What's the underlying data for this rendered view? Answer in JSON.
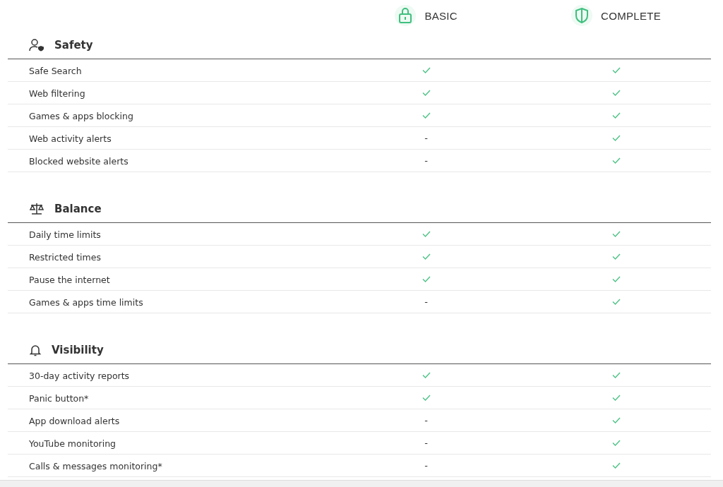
{
  "plans": [
    {
      "name": "BASIC",
      "kind": "lock"
    },
    {
      "name": "COMPLETE",
      "kind": "shield"
    }
  ],
  "sections": [
    {
      "title": "Safety",
      "kind": "person-shield",
      "rows": [
        {
          "feature": "Safe Search",
          "cells": [
            {
              "kind": "check"
            },
            {
              "kind": "check"
            }
          ]
        },
        {
          "feature": "Web filtering",
          "cells": [
            {
              "kind": "check"
            },
            {
              "kind": "check"
            }
          ]
        },
        {
          "feature": "Games & apps blocking",
          "cells": [
            {
              "kind": "check"
            },
            {
              "kind": "check"
            }
          ]
        },
        {
          "feature": "Web activity alerts",
          "cells": [
            {
              "kind": "text",
              "text": "-"
            },
            {
              "kind": "check"
            }
          ]
        },
        {
          "feature": "Blocked website alerts",
          "cells": [
            {
              "kind": "text",
              "text": "-"
            },
            {
              "kind": "check"
            }
          ]
        }
      ]
    },
    {
      "title": "Balance",
      "kind": "scale",
      "rows": [
        {
          "feature": "Daily time limits",
          "cells": [
            {
              "kind": "check"
            },
            {
              "kind": "check"
            }
          ]
        },
        {
          "feature": "Restricted times",
          "cells": [
            {
              "kind": "check"
            },
            {
              "kind": "check"
            }
          ]
        },
        {
          "feature": "Pause the internet",
          "cells": [
            {
              "kind": "check"
            },
            {
              "kind": "check"
            }
          ]
        },
        {
          "feature": "Games & apps time limits",
          "cells": [
            {
              "kind": "text",
              "text": "-"
            },
            {
              "kind": "check"
            }
          ]
        }
      ]
    },
    {
      "title": "Visibility",
      "kind": "bell",
      "rows": [
        {
          "feature": "30-day activity reports",
          "cells": [
            {
              "kind": "check"
            },
            {
              "kind": "check"
            }
          ]
        },
        {
          "feature": "Panic button*",
          "cells": [
            {
              "kind": "check"
            },
            {
              "kind": "check"
            }
          ]
        },
        {
          "feature": "App download alerts",
          "cells": [
            {
              "kind": "text",
              "text": "-"
            },
            {
              "kind": "check"
            }
          ]
        },
        {
          "feature": "YouTube monitoring",
          "cells": [
            {
              "kind": "text",
              "text": "-"
            },
            {
              "kind": "check"
            }
          ]
        },
        {
          "feature": "Calls & messages monitoring*",
          "cells": [
            {
              "kind": "text",
              "text": "-"
            },
            {
              "kind": "check"
            }
          ]
        }
      ]
    }
  ]
}
